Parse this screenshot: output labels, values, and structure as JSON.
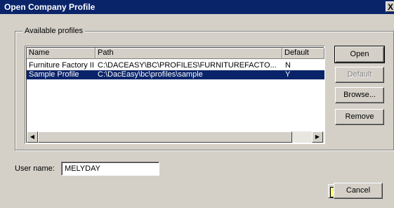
{
  "window": {
    "title": "Open Company Profile",
    "close_glyph": "X"
  },
  "group": {
    "label": "Available profiles"
  },
  "list": {
    "columns": [
      "Name",
      "Path",
      "Default"
    ],
    "rows": [
      {
        "name": "Furniture Factory II",
        "path": "C:\\DACEASY\\BC\\PROFILES\\FURNITUREFACTO...",
        "default": "N",
        "selected": false
      },
      {
        "name": "Sample Profile",
        "path": "C:\\DacEasy\\bc\\profiles\\sample",
        "default": "Y",
        "selected": true
      }
    ],
    "scroll_left": "◀",
    "scroll_right": "▶"
  },
  "buttons": {
    "open": "Open",
    "default": "Default",
    "browse": "Browse...",
    "remove": "Remove",
    "cancel": "Cancel"
  },
  "user": {
    "label": "User name:",
    "value": "MELYDAY"
  },
  "help": {
    "glyph": "?"
  },
  "colors": {
    "titlebar": "#0a246a",
    "selection": "#0a246a",
    "face": "#d4d0c8"
  }
}
